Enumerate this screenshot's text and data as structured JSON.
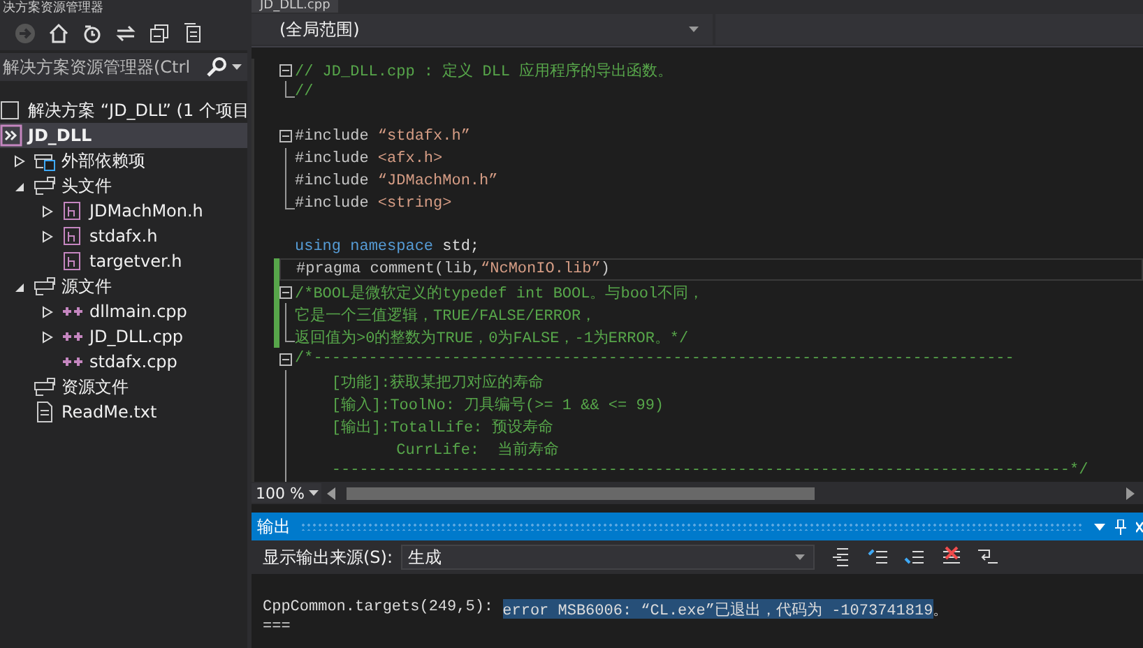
{
  "explorer": {
    "title": "决方案资源管理器",
    "search": {
      "placeholder": "解决方案资源管理器(Ctrl"
    },
    "tree": [
      {
        "label": "解决方案 “JD_DLL” (1 个项目",
        "kind": "solution",
        "selected": false,
        "children": [
          {
            "label": "JD_DLL",
            "kind": "project",
            "selected": true,
            "children": [
              {
                "label": "外部依赖项",
                "kind": "deps",
                "selected": false,
                "expanded": false
              },
              {
                "label": "头文件",
                "kind": "folder",
                "selected": false,
                "expanded": true,
                "children": [
                  {
                    "label": "JDMachMon.h",
                    "kind": "header",
                    "selected": false,
                    "expanded": false
                  },
                  {
                    "label": "stdafx.h",
                    "kind": "header",
                    "selected": false,
                    "expanded": false
                  },
                  {
                    "label": "targetver.h",
                    "kind": "header",
                    "selected": false
                  }
                ]
              },
              {
                "label": "源文件",
                "kind": "folder",
                "selected": false,
                "expanded": true,
                "children": [
                  {
                    "label": "dllmain.cpp",
                    "kind": "cpp",
                    "selected": false,
                    "expanded": false
                  },
                  {
                    "label": "JD_DLL.cpp",
                    "kind": "cpp",
                    "selected": false,
                    "expanded": false
                  },
                  {
                    "label": "stdafx.cpp",
                    "kind": "cpp",
                    "selected": false
                  }
                ]
              },
              {
                "label": "资源文件",
                "kind": "folder",
                "selected": false
              },
              {
                "label": "ReadMe.txt",
                "kind": "txt",
                "selected": false
              }
            ]
          }
        ]
      }
    ]
  },
  "editor": {
    "tab": "JD_DLL.cpp",
    "scope": "(全局范围)",
    "zoom": "100 %",
    "lines": [
      {
        "fold_start": true,
        "segments": [
          {
            "kind": "comment",
            "text": "// JD_DLL.cpp : 定义 DLL 应用程序的导出函数。"
          }
        ]
      },
      {
        "fold_end": true,
        "segments": [
          {
            "kind": "comment",
            "text": "//"
          }
        ]
      },
      {
        "blank_before": true,
        "fold_start": true,
        "segments": [
          {
            "kind": "pre",
            "text": "#include "
          },
          {
            "kind": "string",
            "text": "“stdafx.h”"
          }
        ]
      },
      {
        "segments": [
          {
            "kind": "pre",
            "text": "#include "
          },
          {
            "kind": "string",
            "text": "<afx.h>"
          }
        ]
      },
      {
        "segments": [
          {
            "kind": "pre",
            "text": "#include "
          },
          {
            "kind": "string",
            "text": "“JDMachMon.h”"
          }
        ]
      },
      {
        "fold_end": true,
        "segments": [
          {
            "kind": "pre",
            "text": "#include "
          },
          {
            "kind": "string",
            "text": "<string>"
          }
        ]
      },
      {
        "blank_before": true,
        "segments": [
          {
            "kind": "keyword",
            "text": "using"
          },
          {
            "kind": "keyword",
            "text": " namespace"
          },
          {
            "kind": "plain",
            "text": " std;"
          }
        ]
      },
      {
        "changed": true,
        "current": true,
        "segments": [
          {
            "kind": "pre",
            "text": "#pragma comment(lib,"
          },
          {
            "kind": "string",
            "text": "“NcMonIO.lib”"
          },
          {
            "kind": "pre",
            "text": ")"
          }
        ]
      },
      {
        "fold_start": true,
        "changed": true,
        "segments": [
          {
            "kind": "comment",
            "text": "/*BOOL是微软定义的typedef int BOOL。与bool不同，"
          }
        ]
      },
      {
        "changed": true,
        "segments": [
          {
            "kind": "comment",
            "text": "它是一个三值逻辑，TRUE/FALSE/ERROR，"
          }
        ]
      },
      {
        "fold_end": true,
        "changed": true,
        "segments": [
          {
            "kind": "comment",
            "text": "返回值为>0的整数为TRUE，0为FALSE，-1为ERROR。*/"
          }
        ]
      },
      {
        "fold_start": true,
        "segments": [
          {
            "kind": "comment",
            "text": "/*----------------------------------------------------------------------------"
          }
        ]
      },
      {
        "segments": [
          {
            "kind": "comment",
            "text": "    [功能]:获取某把刀对应的寿命"
          }
        ]
      },
      {
        "segments": [
          {
            "kind": "comment",
            "text": "    [输入]:ToolNo: 刀具编号(>= 1 && <= 99)"
          }
        ]
      },
      {
        "segments": [
          {
            "kind": "comment",
            "text": "    [输出]:TotalLife: 预设寿命"
          }
        ]
      },
      {
        "segments": [
          {
            "kind": "comment",
            "text": "           CurrLife:  当前寿命"
          }
        ]
      },
      {
        "segments": [
          {
            "kind": "comment",
            "text": "    --------------------------------------------------------------------------------*/"
          }
        ]
      }
    ]
  },
  "output": {
    "title": "输出",
    "source_label": "显示输出来源(S):",
    "source": "生成",
    "lines": [
      [
        {
          "text": "CppCommon.targets(249,5): ",
          "selected": false
        },
        {
          "text": "error MSB6006: “CL.exe”已退出，代码为 -1073741819",
          "selected": true
        },
        {
          "text": "。",
          "selected": false
        }
      ],
      [
        {
          "text": "===",
          "selected": false
        }
      ]
    ]
  }
}
